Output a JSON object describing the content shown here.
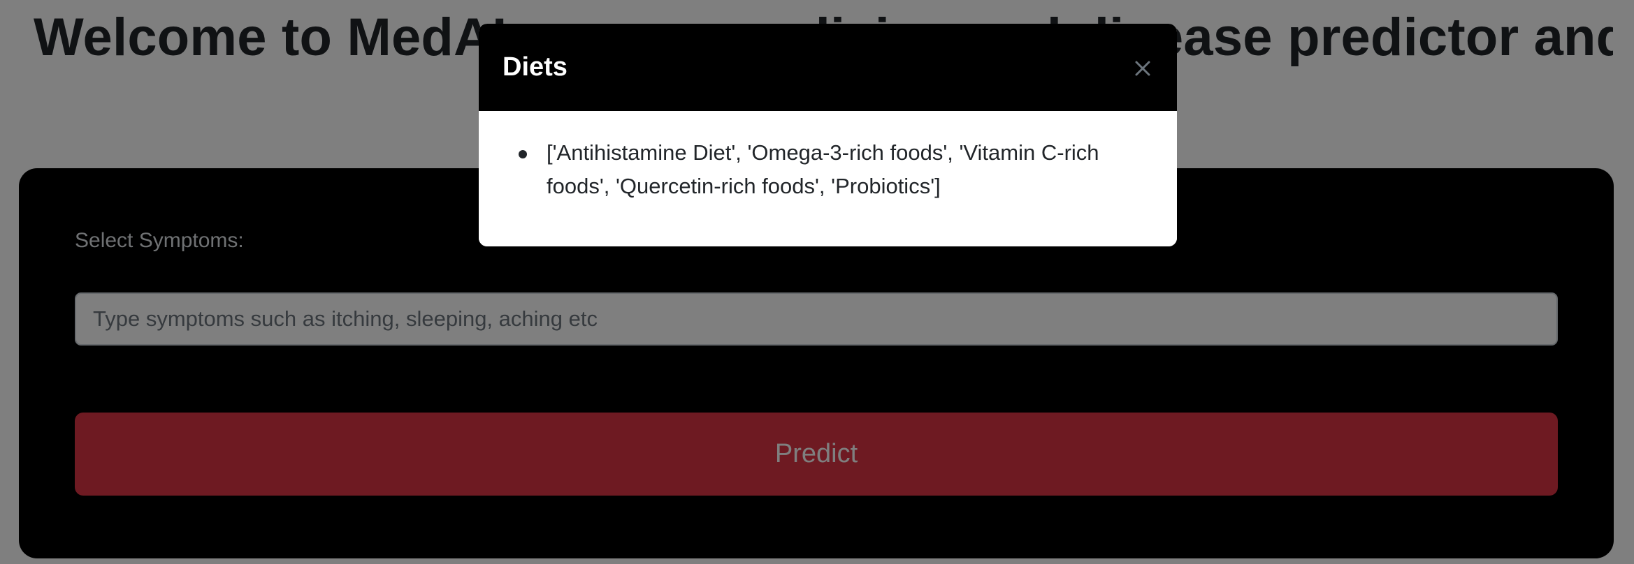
{
  "page": {
    "title": "Welcome to MedAI — your medicine and disease predictor and drug"
  },
  "form": {
    "symptoms_label": "Select Symptoms:",
    "symptoms_placeholder": "Type symptoms such as itching, sleeping, aching etc",
    "predict_label": "Predict"
  },
  "modal": {
    "title": "Diets",
    "close_icon": "close-icon",
    "items": [
      "['Antihistamine Diet', 'Omega-3-rich foods', 'Vitamin C-rich foods', 'Quercetin-rich foods', 'Probiotics']"
    ]
  },
  "colors": {
    "form_card_background": "#000000",
    "predict_button": "#dc3545",
    "modal_header": "#000000",
    "backdrop": "rgba(0,0,0,0.5)"
  }
}
